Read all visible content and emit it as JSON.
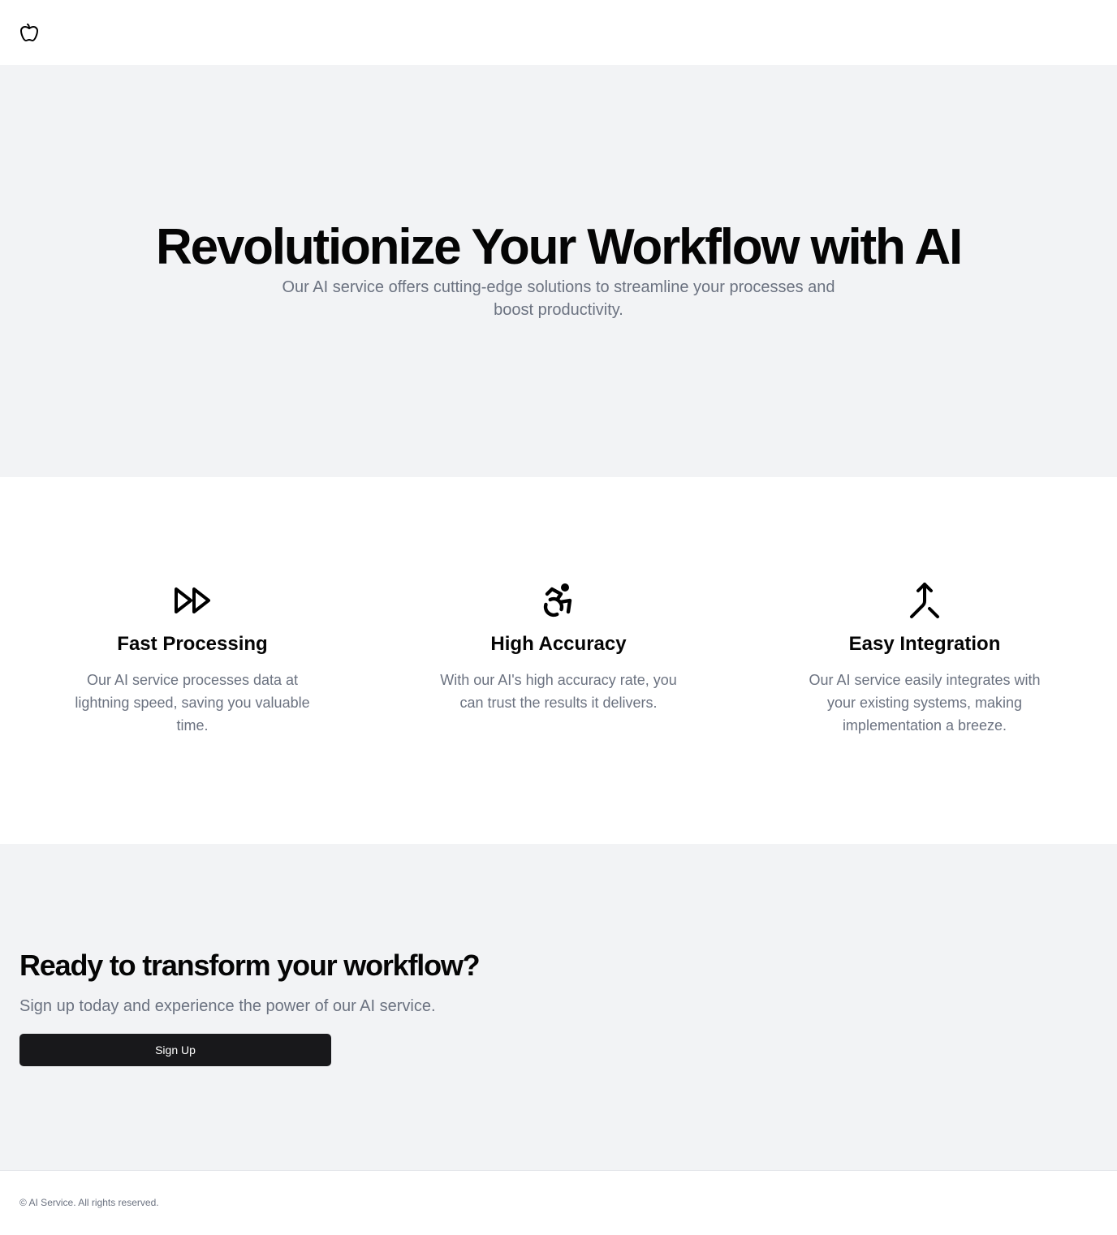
{
  "header": {
    "logo_icon": "apple-icon"
  },
  "hero": {
    "title": "Revolutionize Your Workflow with AI",
    "subtitle": "Our AI service offers cutting-edge solutions to streamline your processes and boost productivity."
  },
  "features": [
    {
      "icon": "fast-forward-icon",
      "title": "Fast Processing",
      "description": "Our AI service processes data at lightning speed, saving you valuable time."
    },
    {
      "icon": "accessibility-icon",
      "title": "High Accuracy",
      "description": "With our AI's high accuracy rate, you can trust the results it delivers."
    },
    {
      "icon": "merge-icon",
      "title": "Easy Integration",
      "description": "Our AI service easily integrates with your existing systems, making implementation a breeze."
    }
  ],
  "cta": {
    "title": "Ready to transform your workflow?",
    "subtitle": "Sign up today and experience the power of our AI service.",
    "button_label": "Sign Up"
  },
  "footer": {
    "copyright": "© AI Service. All rights reserved."
  },
  "colors": {
    "section_gray": "#f2f3f5",
    "button_dark": "#18181b",
    "muted_text": "#6b7280"
  }
}
